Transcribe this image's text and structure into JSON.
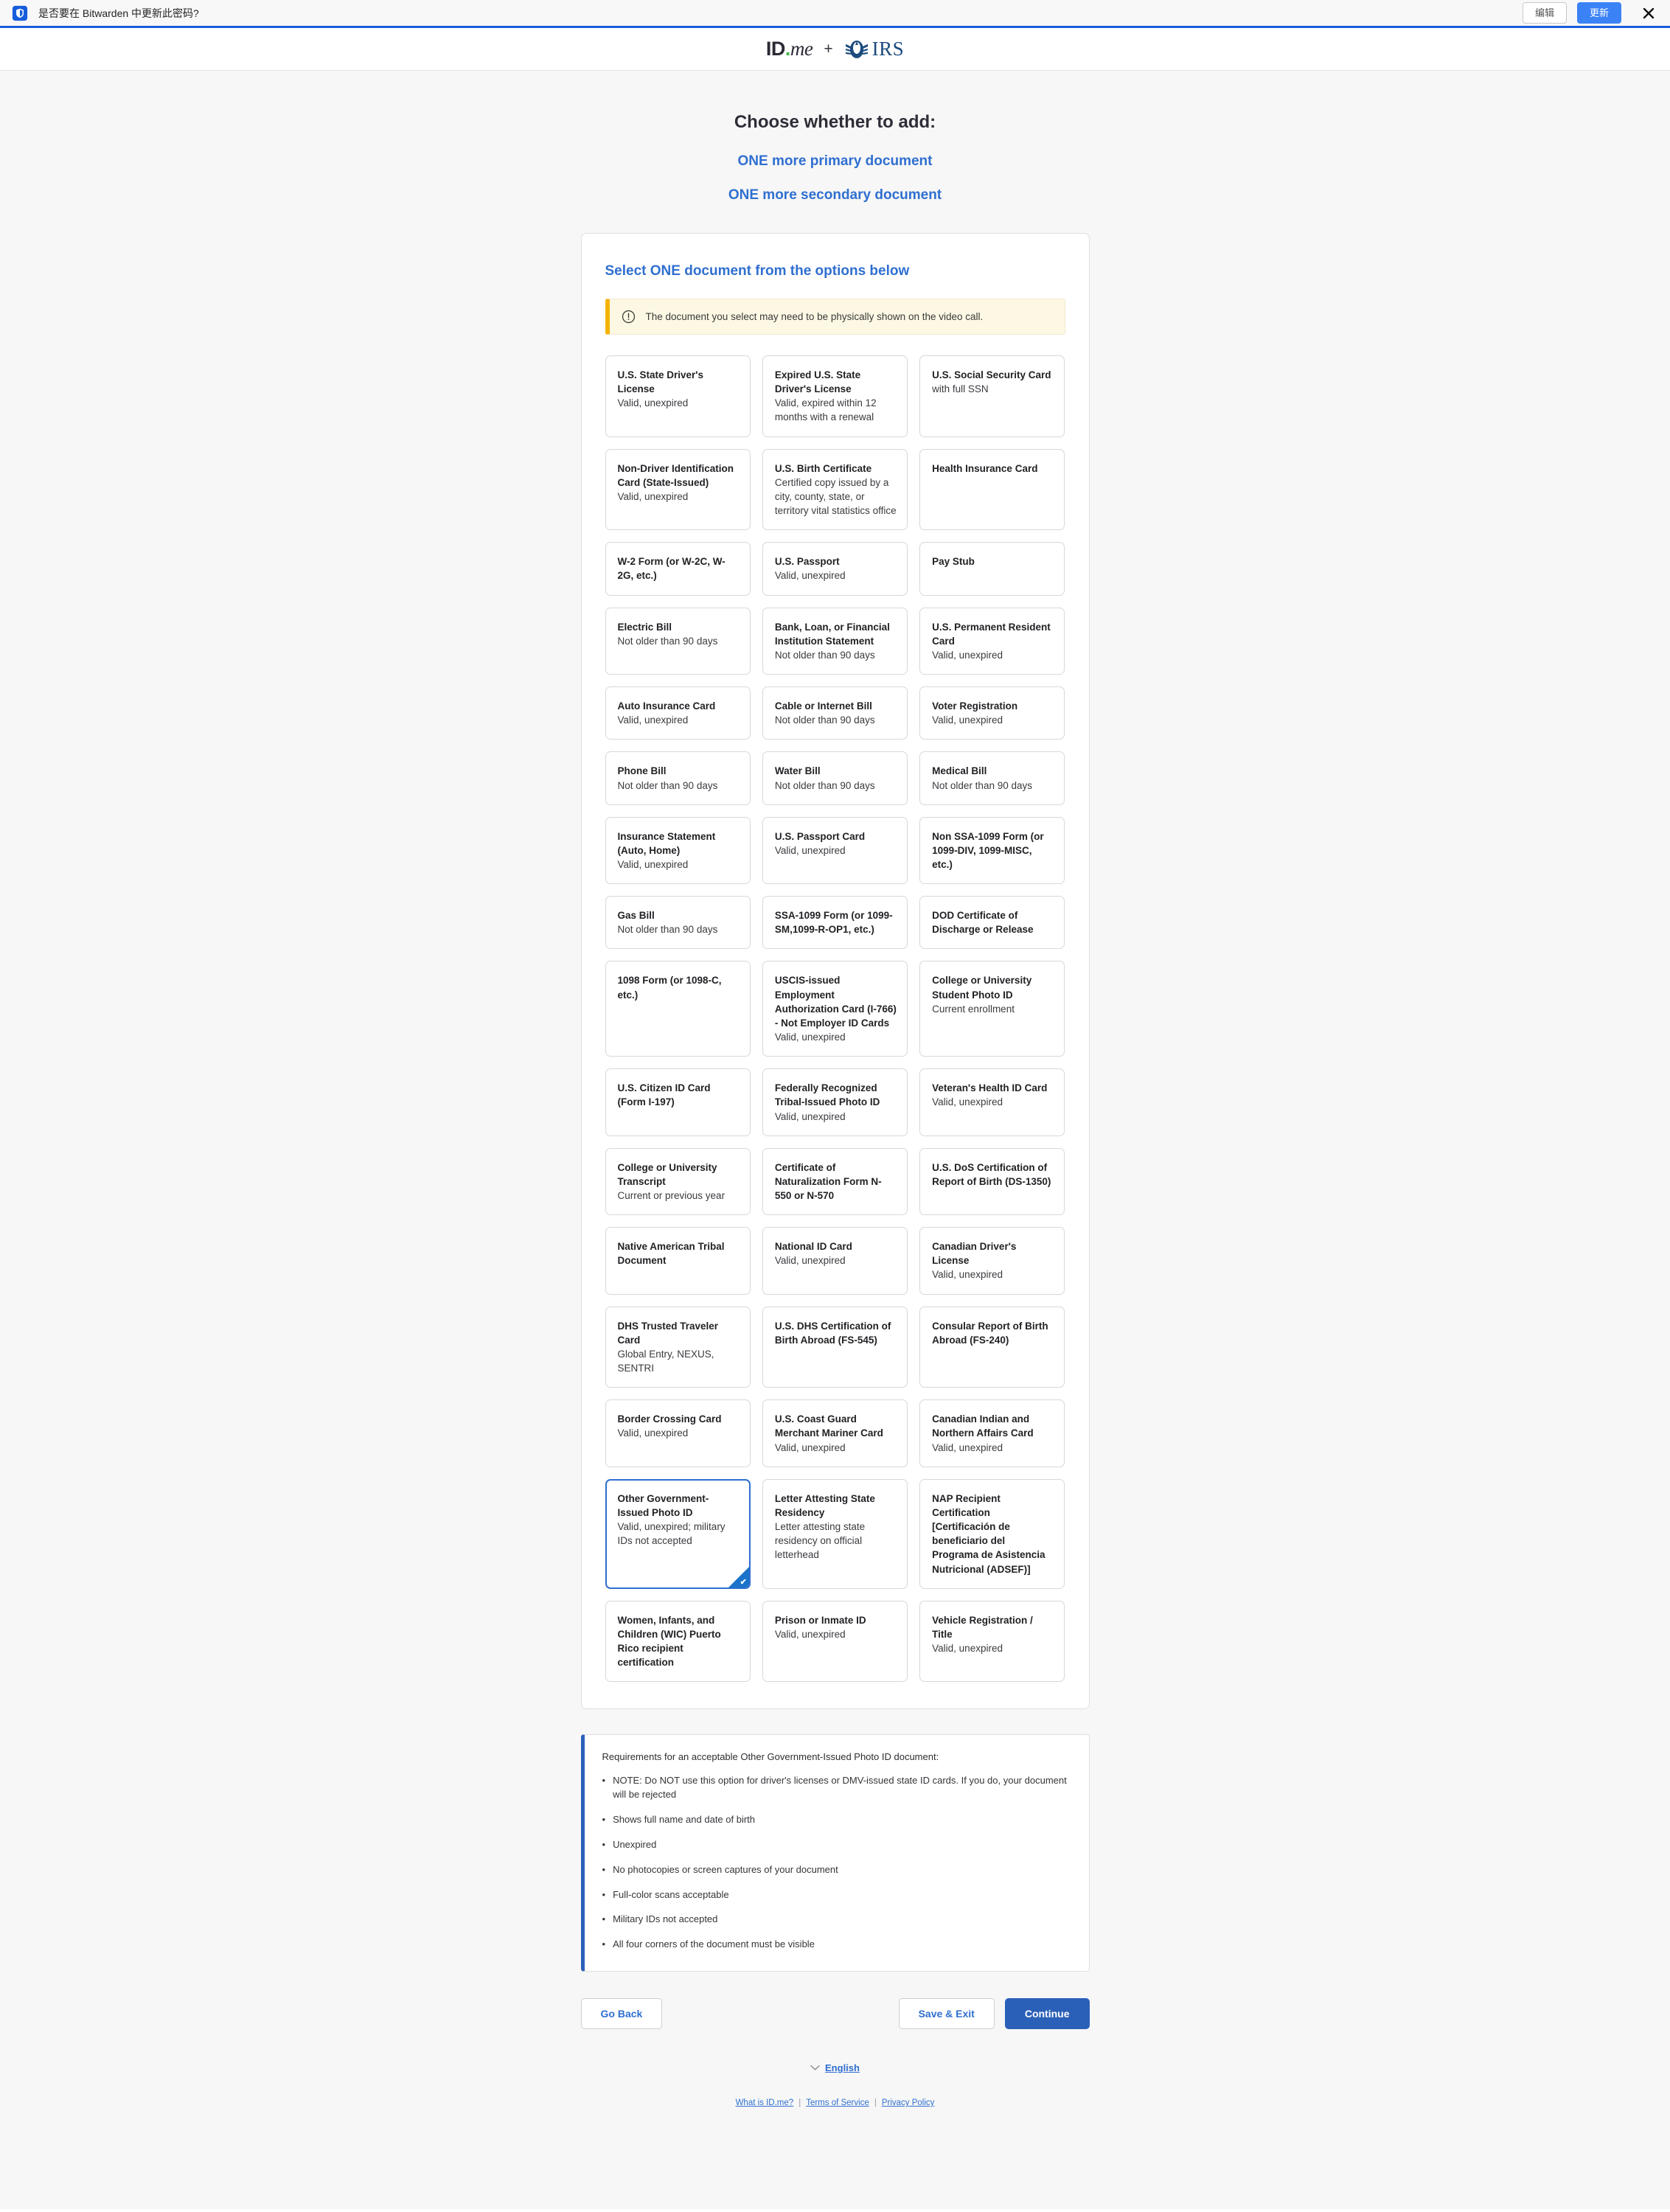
{
  "browser_notification": {
    "icon": "bitwarden-shield-icon",
    "message": "是否要在 Bitwarden 中更新此密码?",
    "edit_label": "编辑",
    "update_label": "更新",
    "close_icon": "close-icon",
    "accent_color": "#175ddc",
    "update_button_color": "#3b82f6"
  },
  "header": {
    "idme_logo": "ID.me",
    "plus": "+",
    "irs_logo": "IRS"
  },
  "headings": {
    "title": "Choose whether to add:",
    "link_primary": "ONE more primary document",
    "link_secondary": "ONE more secondary document",
    "link_color": "#2f6fd0"
  },
  "card": {
    "title": "Select ONE document from the options below",
    "alert": {
      "icon": "exclamation-circle-icon",
      "text": "The document you select may need to be physically shown on the video call.",
      "bg_color": "#fdf8e3",
      "accent_color": "#f5b301"
    }
  },
  "documents": [
    {
      "title": "U.S. State Driver's License",
      "sub": "Valid, unexpired",
      "selected": false
    },
    {
      "title": "Expired U.S. State Driver's License",
      "sub": "Valid, expired within 12 months with a renewal",
      "selected": false
    },
    {
      "title": "U.S. Social Security Card",
      "sub": "with full SSN",
      "selected": false
    },
    {
      "title": "Non-Driver Identification Card (State-Issued)",
      "sub": "Valid, unexpired",
      "selected": false
    },
    {
      "title": "U.S. Birth Certificate",
      "sub": "Certified copy issued by a city, county, state, or territory vital statistics office",
      "selected": false
    },
    {
      "title": "Health Insurance Card",
      "sub": "",
      "selected": false
    },
    {
      "title": "W-2 Form (or W-2C, W-2G, etc.)",
      "sub": "",
      "selected": false
    },
    {
      "title": "U.S. Passport",
      "sub": "Valid, unexpired",
      "selected": false
    },
    {
      "title": "Pay Stub",
      "sub": "",
      "selected": false
    },
    {
      "title": "Electric Bill",
      "sub": "Not older than 90 days",
      "selected": false
    },
    {
      "title": "Bank, Loan, or Financial Institution Statement",
      "sub": "Not older than 90 days",
      "selected": false
    },
    {
      "title": "U.S. Permanent Resident Card",
      "sub": "Valid, unexpired",
      "selected": false
    },
    {
      "title": "Auto Insurance Card",
      "sub": "Valid, unexpired",
      "selected": false
    },
    {
      "title": "Cable or Internet Bill",
      "sub": "Not older than 90 days",
      "selected": false
    },
    {
      "title": "Voter Registration",
      "sub": "Valid, unexpired",
      "selected": false
    },
    {
      "title": "Phone Bill",
      "sub": "Not older than 90 days",
      "selected": false
    },
    {
      "title": "Water Bill",
      "sub": "Not older than 90 days",
      "selected": false
    },
    {
      "title": "Medical Bill",
      "sub": "Not older than 90 days",
      "selected": false
    },
    {
      "title": "Insurance Statement (Auto, Home)",
      "sub": "Valid, unexpired",
      "selected": false
    },
    {
      "title": "U.S. Passport Card",
      "sub": "Valid, unexpired",
      "selected": false
    },
    {
      "title": "Non SSA-1099 Form (or 1099-DIV, 1099-MISC, etc.)",
      "sub": "",
      "selected": false
    },
    {
      "title": "Gas Bill",
      "sub": "Not older than 90 days",
      "selected": false
    },
    {
      "title": "SSA-1099 Form (or 1099-SM,1099-R-OP1, etc.)",
      "sub": "",
      "selected": false
    },
    {
      "title": "DOD Certificate of Discharge or Release",
      "sub": "",
      "selected": false
    },
    {
      "title": "1098 Form (or 1098-C, etc.)",
      "sub": "",
      "selected": false
    },
    {
      "title": "USCIS-issued Employment Authorization Card (I-766) - Not Employer ID Cards",
      "sub": "Valid, unexpired",
      "selected": false
    },
    {
      "title": "College or University Student Photo ID",
      "sub": "Current enrollment",
      "selected": false
    },
    {
      "title": "U.S. Citizen ID Card (Form I-197)",
      "sub": "",
      "selected": false
    },
    {
      "title": "Federally Recognized Tribal-Issued Photo ID",
      "sub": "Valid, unexpired",
      "selected": false
    },
    {
      "title": "Veteran's Health ID Card",
      "sub": "Valid, unexpired",
      "selected": false
    },
    {
      "title": "College or University Transcript",
      "sub": "Current or previous year",
      "selected": false
    },
    {
      "title": "Certificate of Naturalization Form N-550 or N-570",
      "sub": "",
      "selected": false
    },
    {
      "title": "U.S. DoS Certification of Report of Birth (DS-1350)",
      "sub": "",
      "selected": false
    },
    {
      "title": "Native American Tribal Document",
      "sub": "",
      "selected": false
    },
    {
      "title": "National ID Card",
      "sub": "Valid, unexpired",
      "selected": false
    },
    {
      "title": "Canadian Driver's License",
      "sub": "Valid, unexpired",
      "selected": false
    },
    {
      "title": "DHS Trusted Traveler Card",
      "sub": "Global Entry, NEXUS, SENTRI",
      "selected": false
    },
    {
      "title": "U.S. DHS Certification of Birth Abroad (FS-545)",
      "sub": "",
      "selected": false
    },
    {
      "title": "Consular Report of Birth Abroad (FS-240)",
      "sub": "",
      "selected": false
    },
    {
      "title": "Border Crossing Card",
      "sub": "Valid, unexpired",
      "selected": false
    },
    {
      "title": "U.S. Coast Guard Merchant Mariner Card",
      "sub": "Valid, unexpired",
      "selected": false
    },
    {
      "title": "Canadian Indian and Northern Affairs Card",
      "sub": "Valid, unexpired",
      "selected": false
    },
    {
      "title": "Other Government-Issued Photo ID",
      "sub": "Valid, unexpired; military IDs not accepted",
      "selected": true
    },
    {
      "title": "Letter Attesting State Residency",
      "sub": "Letter attesting state residency on official letterhead",
      "selected": false
    },
    {
      "title": "NAP Recipient Certification [Certificación de beneficiario del Programa de Asistencia Nutricional (ADSEF)]",
      "sub": "",
      "selected": false
    },
    {
      "title": "Women, Infants, and Children (WIC) Puerto Rico recipient certification",
      "sub": "",
      "selected": false
    },
    {
      "title": "Prison or Inmate ID",
      "sub": "Valid, unexpired",
      "selected": false
    },
    {
      "title": "Vehicle Registration / Title",
      "sub": "Valid, unexpired",
      "selected": false
    }
  ],
  "requirements": {
    "title": "Requirements for an acceptable Other Government-Issued Photo ID document:",
    "items": [
      "NOTE: Do NOT use this option for driver's licenses or DMV-issued state ID cards. If you do, your document will be rejected",
      "Shows full name and date of birth",
      "Unexpired",
      "No photocopies or screen captures of your document",
      "Full-color scans acceptable",
      "Military IDs not accepted",
      "All four corners of the document must be visible"
    ],
    "accent_color": "#2b60b8"
  },
  "actions": {
    "go_back": "Go Back",
    "save_exit": "Save & Exit",
    "continue": "Continue",
    "continue_color": "#2b60b8"
  },
  "footer": {
    "language": "English",
    "chevron_icon": "chevron-down-icon",
    "links": [
      "What is ID.me?",
      "Terms of Service",
      "Privacy Policy"
    ],
    "separator": "|"
  }
}
